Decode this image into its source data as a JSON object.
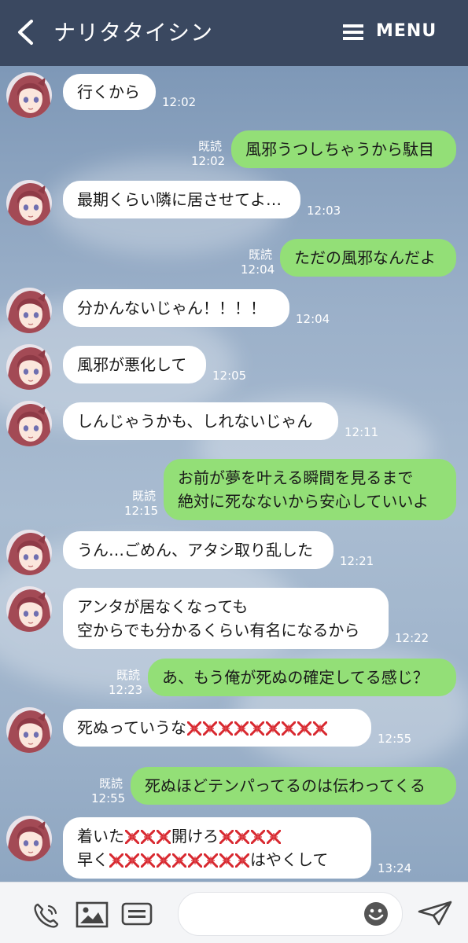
{
  "header": {
    "title": "ナリタタイシン",
    "menu_label": "MENU"
  },
  "colors": {
    "header_bg": "#3a4860",
    "incoming_bubble": "#ffffff",
    "outgoing_bubble": "#93df77"
  },
  "read_label": "既読",
  "messages": [
    {
      "side": "in",
      "lines": [
        "行くから"
      ],
      "time": "12:02"
    },
    {
      "side": "out",
      "lines": [
        "風邪うつしちゃうから駄目"
      ],
      "time": "12:02",
      "read": "既読"
    },
    {
      "side": "in",
      "lines": [
        "最期くらい隣に居させてよ…"
      ],
      "time": "12:03"
    },
    {
      "side": "out",
      "lines": [
        "ただの風邪なんだよ"
      ],
      "time": "12:04",
      "read": "既読"
    },
    {
      "side": "in",
      "lines": [
        "分かんないじゃん！！！！"
      ],
      "time": "12:04"
    },
    {
      "side": "in",
      "lines": [
        "風邪が悪化して"
      ],
      "time": "12:05"
    },
    {
      "side": "in",
      "lines": [
        "しんじゃうかも、しれないじゃん"
      ],
      "time": "12:11"
    },
    {
      "side": "out",
      "lines": [
        "お前が夢を叶える瞬間を見るまで",
        "絶対に死なないから安心していいよ"
      ],
      "time": "12:15",
      "read": "既読"
    },
    {
      "side": "in",
      "lines": [
        "うん…ごめん、アタシ取り乱した"
      ],
      "time": "12:21"
    },
    {
      "side": "in",
      "lines": [
        "アンタが居なくなっても",
        "空からでも分かるくらい有名になるから"
      ],
      "time": "12:22"
    },
    {
      "side": "out",
      "lines": [
        "あ、もう俺が死ぬの確定してる感じ？"
      ],
      "time": "12:23",
      "read": "既読"
    },
    {
      "side": "in",
      "lines": [
        "死ぬっていうな"
      ],
      "time": "12:55"
    },
    {
      "side": "out",
      "lines": [
        "死ぬほどテンパってるのは伝わってくる"
      ],
      "time": "12:55",
      "read": "既読"
    },
    {
      "side": "in",
      "lines": [
        "着いた",
        "開けろ",
        "早く",
        "はやくして"
      ],
      "time": "13:24"
    }
  ],
  "footer": {
    "input_placeholder": ""
  }
}
